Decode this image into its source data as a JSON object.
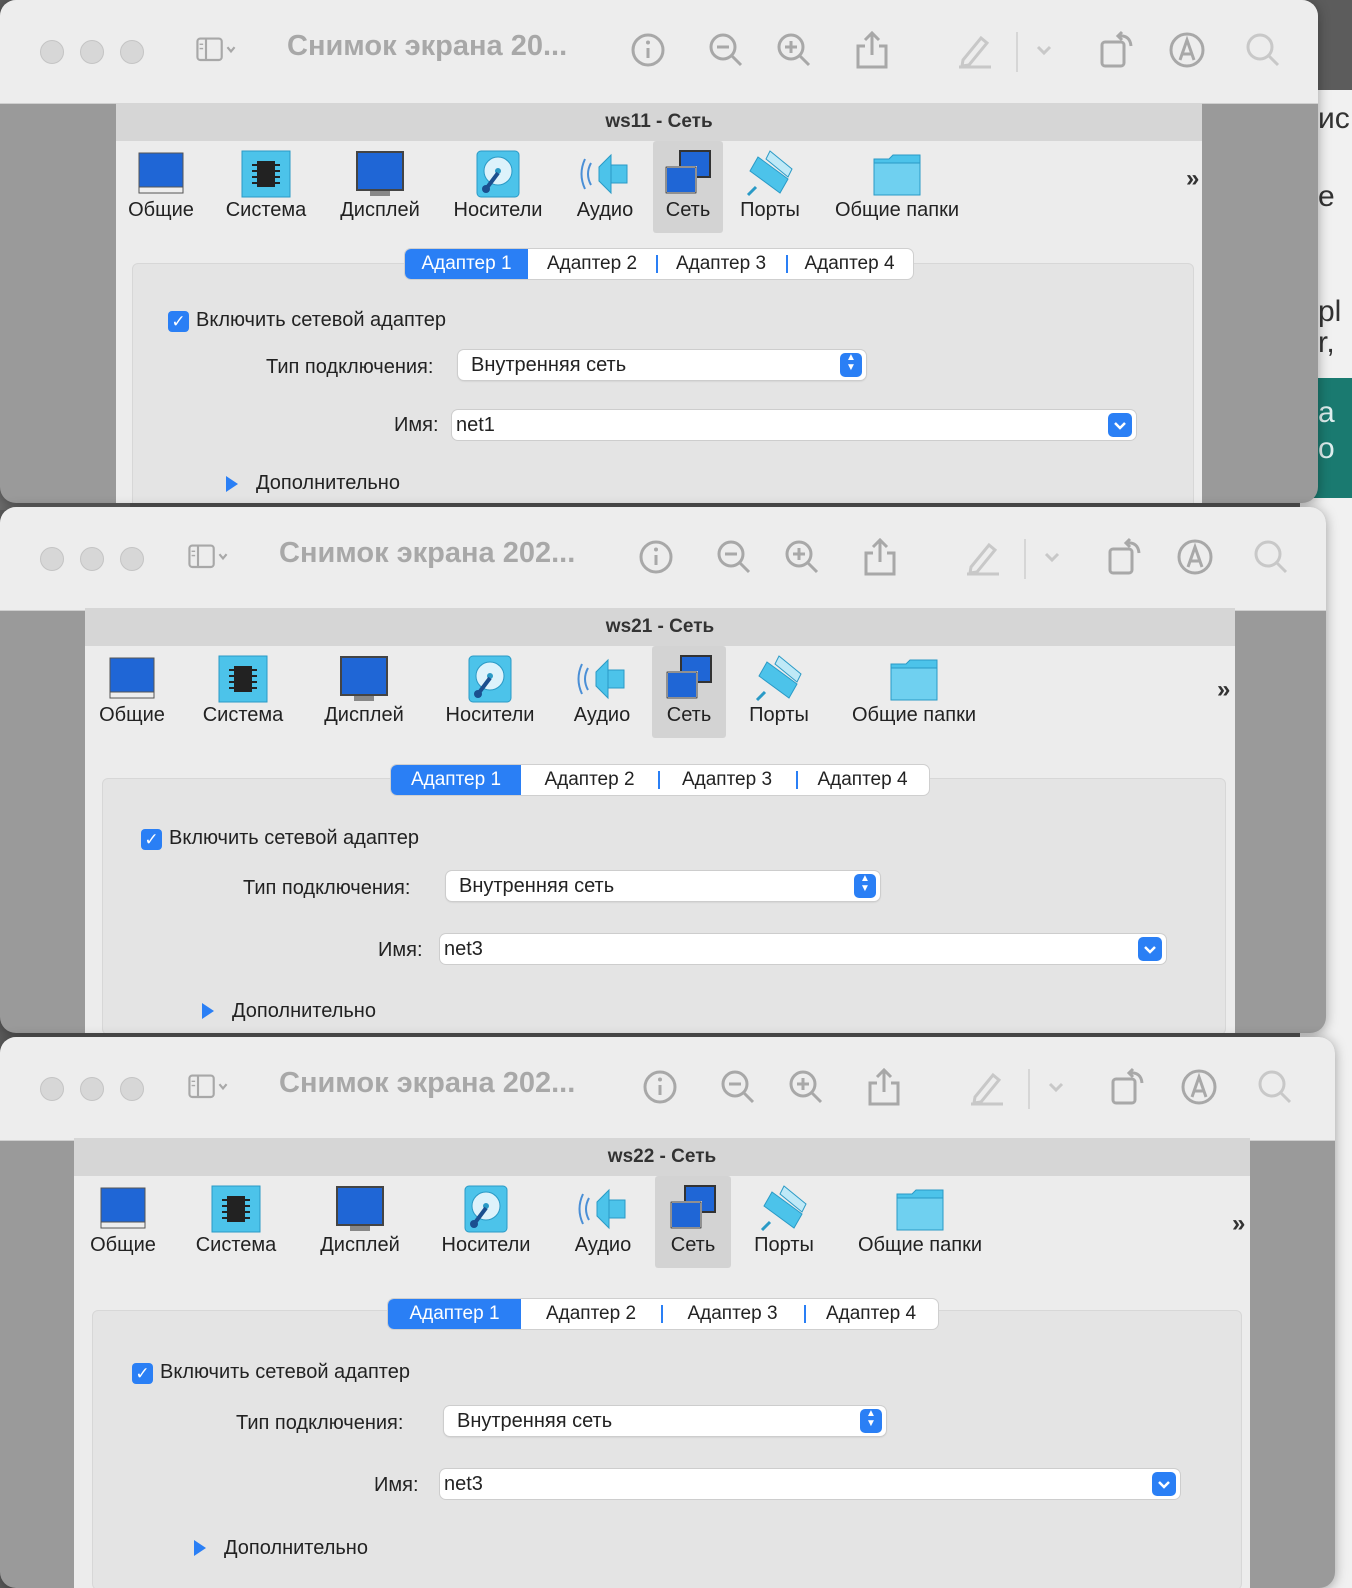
{
  "windows": [
    {
      "titlebar_title": "Снимок экрана 20...",
      "dialog_title": "ws11 - Сеть",
      "tools": [
        "Общие",
        "Система",
        "Дисплей",
        "Носители",
        "Аудио",
        "Сеть",
        "Порты",
        "Общие папки"
      ],
      "selected_tool": "Сеть",
      "tabs": [
        "Адаптер 1",
        "Адаптер 2",
        "Адаптер 3",
        "Адаптер 4"
      ],
      "active_tab": "Адаптер 1",
      "enable_label": "Включить сетевой адаптер",
      "enable_checked": true,
      "attach_label": "Тип подключения:",
      "attach_value": "Внутренняя сеть",
      "name_label": "Имя:",
      "name_value": "net1",
      "advanced_label": "Дополнительно"
    },
    {
      "titlebar_title": "Снимок экрана 202...",
      "dialog_title": "ws21 - Сеть",
      "tools": [
        "Общие",
        "Система",
        "Дисплей",
        "Носители",
        "Аудио",
        "Сеть",
        "Порты",
        "Общие папки"
      ],
      "selected_tool": "Сеть",
      "tabs": [
        "Адаптер 1",
        "Адаптер 2",
        "Адаптер 3",
        "Адаптер 4"
      ],
      "active_tab": "Адаптер 1",
      "enable_label": "Включить сетевой адаптер",
      "enable_checked": true,
      "attach_label": "Тип подключения:",
      "attach_value": "Внутренняя сеть",
      "name_label": "Имя:",
      "name_value": "net3",
      "advanced_label": "Дополнительно"
    },
    {
      "titlebar_title": "Снимок экрана 202...",
      "dialog_title": "ws22 - Сеть",
      "tools": [
        "Общие",
        "Система",
        "Дисплей",
        "Носители",
        "Аудио",
        "Сеть",
        "Порты",
        "Общие папки"
      ],
      "selected_tool": "Сеть",
      "tabs": [
        "Адаптер 1",
        "Адаптер 2",
        "Адаптер 3",
        "Адаптер 4"
      ],
      "active_tab": "Адаптер 1",
      "enable_label": "Включить сетевой адаптер",
      "enable_checked": true,
      "attach_label": "Тип подключения:",
      "attach_value": "Внутренняя сеть",
      "name_label": "Имя:",
      "name_value": "net3",
      "advanced_label": "Дополнительно"
    }
  ],
  "background_fragments": [
    "ис",
    "е",
    "pl",
    "r,",
    "а",
    "о"
  ],
  "toolbar_icons": [
    "sidebar-icon",
    "info-icon",
    "zoom-out-icon",
    "zoom-in-icon",
    "share-icon",
    "markup-icon",
    "rotate-icon",
    "highlight-icon",
    "search-icon"
  ],
  "colors": {
    "accent": "#2a7ff5",
    "title_gray": "#a8a8a8"
  }
}
